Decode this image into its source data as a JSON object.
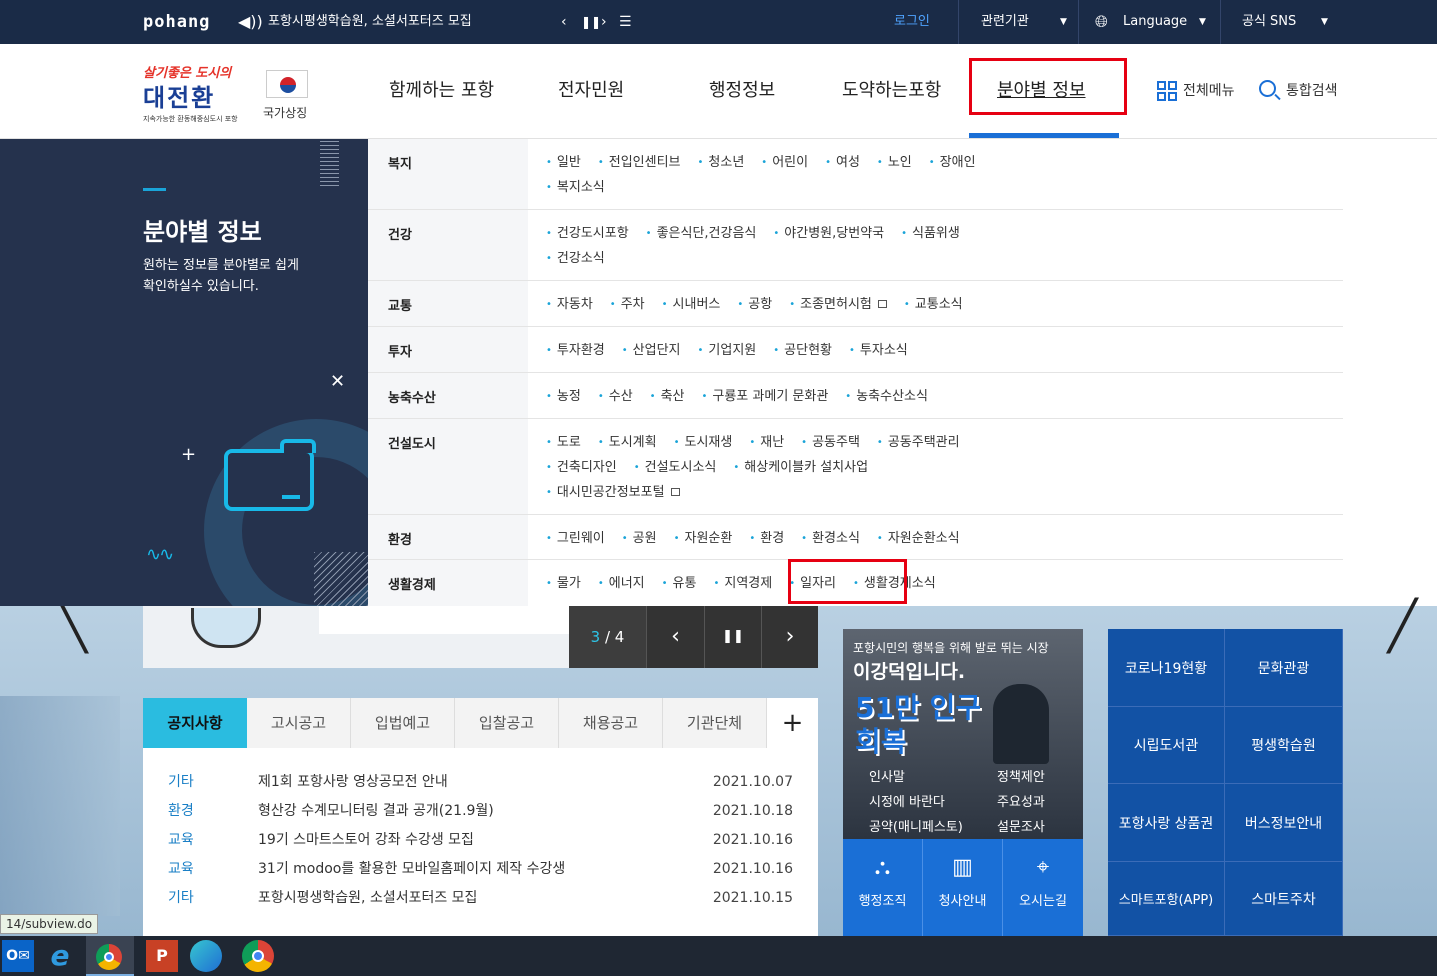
{
  "topbar": {
    "logo": "pohang",
    "notice": "포항시평생학습원, 소셜서포터즈 모집",
    "login": "로그인",
    "related": "관련기관",
    "language": "Language",
    "sns": "공식 SNS"
  },
  "header": {
    "slogan_line1": "살기좋은 도시의",
    "slogan_line2": "대전환",
    "slogan_sub": "지속가능한 환동해중심도시 포항",
    "national_symbol": "국가상징",
    "nav": [
      "함께하는 포항",
      "전자민원",
      "행정정보",
      "도약하는포항",
      "분야별 정보"
    ],
    "all_menu": "전체메뉴",
    "search": "통합검색"
  },
  "leftpanel": {
    "title": "분야별 정보",
    "desc_line1": "원하는 정보를 분야별로 쉽게",
    "desc_line2": "확인하실수 있습니다."
  },
  "menu": [
    {
      "category": "복지",
      "items": [
        "일반",
        "전입인센티브",
        "청소년",
        "어린이",
        "여성",
        "노인",
        "장애인",
        "복지소식"
      ]
    },
    {
      "category": "건강",
      "items": [
        "건강도시포항",
        "좋은식단,건강음식",
        "야간병원,당번약국",
        "식품위생",
        "건강소식"
      ]
    },
    {
      "category": "교통",
      "items": [
        "자동차",
        "주차",
        "시내버스",
        "공항",
        "조종면허시험",
        "교통소식"
      ]
    },
    {
      "category": "투자",
      "items": [
        "투자환경",
        "산업단지",
        "기업지원",
        "공단현황",
        "투자소식"
      ]
    },
    {
      "category": "농축수산",
      "items": [
        "농정",
        "수산",
        "축산",
        "구룡포 과메기 문화관",
        "농축수산소식"
      ]
    },
    {
      "category": "건설도시",
      "items": [
        "도로",
        "도시계획",
        "도시재생",
        "재난",
        "공동주택",
        "공동주택관리",
        "건축디자인",
        "건설도시소식",
        "해상케이블카 설치사업",
        "대시민공간정보포털"
      ]
    },
    {
      "category": "환경",
      "items": [
        "그린웨이",
        "공원",
        "자원순환",
        "환경",
        "환경소식",
        "자원순환소식"
      ]
    },
    {
      "category": "생활경제",
      "items": [
        "물가",
        "에너지",
        "유통",
        "지역경제",
        "일자리",
        "생활경제소식"
      ]
    }
  ],
  "slider": {
    "counter_current": "3",
    "counter_total": "/ 4"
  },
  "notice_board": {
    "tabs": [
      "공지사항",
      "고시공고",
      "입법예고",
      "입찰공고",
      "채용공고",
      "기관단체"
    ],
    "more": "+",
    "rows": [
      {
        "category": "기타",
        "title": "제1회 포항사랑 영상공모전 안내",
        "date": "2021.10.07"
      },
      {
        "category": "환경",
        "title": "형산강 수계모니터링 결과 공개(21.9월)",
        "date": "2021.10.18"
      },
      {
        "category": "교육",
        "title": "19기 스마트스토어 강좌 수강생 모집",
        "date": "2021.10.16"
      },
      {
        "category": "교육",
        "title": "31기 modoo를 활용한 모바일홈페이지 제작 수강생",
        "date": "2021.10.16"
      },
      {
        "category": "기타",
        "title": "포항시평생학습원, 소셜서포터즈 모집",
        "date": "2021.10.15"
      }
    ]
  },
  "mayor_banner": {
    "line1": "포항시민의 행복을 위해 발로 뛰는 시장",
    "line2": "이강덕입니다.",
    "big": "51만 인구회복",
    "links": [
      "인사말",
      "정책제안",
      "시정에 바란다",
      "주요성과",
      "공약(매니페스토)",
      "설문조사"
    ]
  },
  "mayor_icons": [
    "행정조직",
    "청사안내",
    "오시는길"
  ],
  "quick_links": [
    "코로나19현황",
    "문화관광",
    "시립도서관",
    "평생학습원",
    "포항사랑 상품권",
    "버스정보안내",
    "스마트포항(APP)",
    "스마트주차"
  ],
  "status_url": "14/subview.do",
  "colors": {
    "navy": "#1a2b47",
    "accent": "#1aa4d8",
    "highlight": "#e60012",
    "quick_blue": "#1252a5"
  }
}
